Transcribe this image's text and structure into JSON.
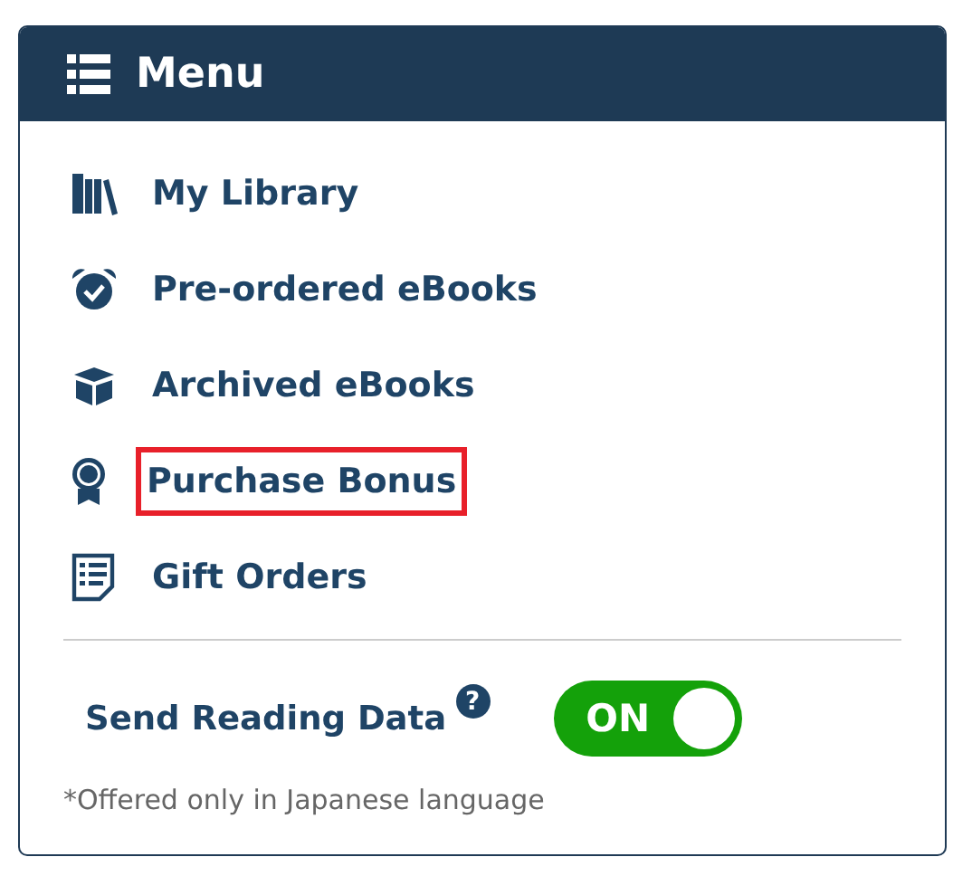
{
  "header": {
    "title": "Menu"
  },
  "items": [
    {
      "label": "My Library",
      "highlighted": false
    },
    {
      "label": "Pre-ordered eBooks",
      "highlighted": false
    },
    {
      "label": "Archived eBooks",
      "highlighted": false
    },
    {
      "label": "Purchase Bonus",
      "highlighted": true
    },
    {
      "label": "Gift Orders",
      "highlighted": false
    }
  ],
  "setting": {
    "label": "Send Reading Data",
    "help": "?",
    "toggle": {
      "text": "ON",
      "on": true
    }
  },
  "note": "*Offered only in Japanese language"
}
